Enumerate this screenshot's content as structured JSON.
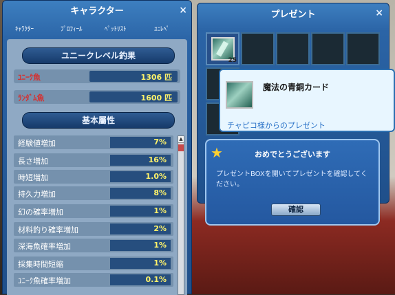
{
  "character_window": {
    "title": "キャラクター",
    "close_symbol": "×",
    "tabs": [
      "ｷｬﾗｸﾀｰ",
      "ﾌﾟﾛﾌｨｰﾙ",
      "ﾍﾟｯﾄﾘｽﾄ",
      "ﾕﾆﾚﾍﾟ"
    ],
    "unique_level_header": "ユニークレベル釣果",
    "catch_stats": [
      {
        "label": "ﾕﾆｰｸ魚",
        "value": "1306 匹"
      },
      {
        "label": "ﾗﾝﾀﾞﾑ魚",
        "value": "1600 匹"
      }
    ],
    "base_attr_header": "基本屬性",
    "attributes": [
      {
        "label": "経験値増加",
        "value": "7%"
      },
      {
        "label": "長さ増加",
        "value": "16%"
      },
      {
        "label": "時短増加",
        "value": "1.0%"
      },
      {
        "label": "持久力増加",
        "value": "8%"
      },
      {
        "label": "幻の確率増加",
        "value": "1%"
      },
      {
        "label": "材料釣り確率増加",
        "value": "2%"
      },
      {
        "label": "深海魚確率増加",
        "value": "1%"
      },
      {
        "label": "採集時間短縮",
        "value": "1%"
      },
      {
        "label": "ﾕﾆｰｸ魚確率増加",
        "value": "0.1%"
      }
    ],
    "scroll_up_symbol": "▲"
  },
  "present_window": {
    "title": "プレゼント",
    "close_symbol": "×",
    "first_slot_count": "25"
  },
  "item_tooltip": {
    "name": "魔法の青銅カード",
    "from": "チャピコ様からのプレゼント"
  },
  "dialog": {
    "title": "おめでとうございます",
    "message": "プレゼントBOXを開いてプレゼントを確認してください。",
    "button_label": "確認",
    "star_symbol": "★"
  },
  "colors": {
    "window_blue": "#2b64a6",
    "value_yellow": "#fff36a",
    "stat_label_red": "#d63030",
    "tooltip_link_blue": "#2a72c8"
  }
}
